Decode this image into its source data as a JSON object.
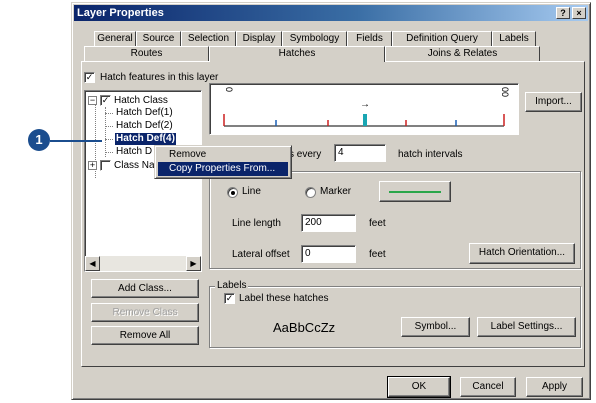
{
  "dialog": {
    "title": "Layer Properties",
    "help_label": "?",
    "close_label": "×"
  },
  "tabs_row1": [
    "General",
    "Source",
    "Selection",
    "Display",
    "Symbology",
    "Fields",
    "Definition Query",
    "Labels"
  ],
  "tabs_row2": [
    "Routes",
    "Hatches",
    "Joins & Relates"
  ],
  "active_tab": "Hatches",
  "hatch_features_label": "Hatch features in this layer",
  "tree": {
    "root_label": "Hatch Class",
    "items": [
      "Hatch Def(1)",
      "Hatch Def(2)",
      "Hatch Def(4)",
      "Hatch D"
    ],
    "class_label": "Class Na"
  },
  "preview": {
    "start_label": "0",
    "end_label": "00",
    "arrow": "→",
    "tick_colors": [
      "#cc2020",
      "#1a5fb4",
      "#cc2020",
      "#1a5fb4",
      "#cc2020"
    ],
    "accent_color": "#1aa6b3"
  },
  "buttons": {
    "import": "Import...",
    "add_class": "Add Class...",
    "remove_class": "Remove Class",
    "remove_all": "Remove All",
    "hatch_orientation": "Hatch Orientation...",
    "symbol": "Symbol...",
    "label_settings": "Label Settings...",
    "ok": "OK",
    "cancel": "Cancel",
    "apply": "Apply"
  },
  "interval": {
    "prefix": "s every",
    "value": "4",
    "suffix": "hatch intervals"
  },
  "line_marker": {
    "line_label": "Line",
    "marker_label": "Marker",
    "selected": "Line",
    "line_color": "#2aa64a"
  },
  "line_length": {
    "label": "Line length",
    "value": "200",
    "unit": "feet"
  },
  "lateral_offset": {
    "label": "Lateral offset",
    "value": "0",
    "unit": "feet"
  },
  "labels_group": {
    "title": "Labels",
    "checkbox_label": "Label these hatches",
    "sample_text": "AaBbCcZz"
  },
  "context_menu": {
    "items": [
      "Remove",
      "Copy Properties From..."
    ],
    "highlighted": "Copy Properties From..."
  },
  "callout": {
    "number": "1"
  }
}
